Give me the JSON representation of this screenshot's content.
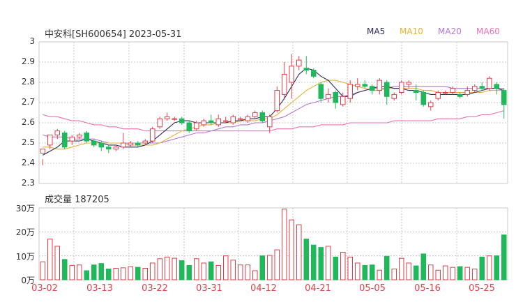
{
  "header": {
    "title": "中安科[SH600654] 2023-05-31"
  },
  "legend": [
    {
      "label": "MA5",
      "color": "#2c2c5e"
    },
    {
      "label": "MA10",
      "color": "#e8b233"
    },
    {
      "label": "MA20",
      "color": "#b476d4"
    },
    {
      "label": "MA60",
      "color": "#f06fb0"
    }
  ],
  "volume_title": "成交量 187205",
  "colors": {
    "up": "#e0404a",
    "down": "#1fb85a",
    "grid": "#c8c8c8",
    "axis_text": "#333333",
    "date_text": "#e0404a"
  },
  "chart_data": [
    {
      "type": "candlestick",
      "title": "中安科[SH600654] 2023-05-31",
      "ylim": [
        2.3,
        3.0
      ],
      "yticks": [
        "3",
        "2.9",
        "2.8",
        "2.7",
        "2.6",
        "2.5",
        "2.4",
        "2.3"
      ],
      "xticks": [
        "03-02",
        "03-13",
        "03-22",
        "03-31",
        "04-12",
        "04-21",
        "05-05",
        "05-16",
        "05-25"
      ],
      "candles": [
        [
          2.45,
          2.47,
          2.42,
          2.39
        ],
        [
          2.49,
          2.54,
          2.47,
          2.49
        ],
        [
          2.54,
          2.56,
          2.52,
          2.57
        ],
        [
          2.55,
          2.48,
          2.47,
          2.56
        ],
        [
          2.51,
          2.53,
          2.49,
          2.54
        ],
        [
          2.53,
          2.54,
          2.52,
          2.55
        ],
        [
          2.55,
          2.51,
          2.5,
          2.56
        ],
        [
          2.51,
          2.49,
          2.48,
          2.52
        ],
        [
          2.5,
          2.48,
          2.46,
          2.51
        ],
        [
          2.48,
          2.47,
          2.45,
          2.49
        ],
        [
          2.47,
          2.48,
          2.46,
          2.49
        ],
        [
          2.48,
          2.5,
          2.47,
          2.55
        ],
        [
          2.49,
          2.5,
          2.48,
          2.51
        ],
        [
          2.5,
          2.49,
          2.48,
          2.51
        ],
        [
          2.5,
          2.51,
          2.49,
          2.52
        ],
        [
          2.51,
          2.57,
          2.5,
          2.58
        ],
        [
          2.58,
          2.62,
          2.57,
          2.63
        ],
        [
          2.62,
          2.63,
          2.61,
          2.65
        ],
        [
          2.62,
          2.62,
          2.61,
          2.63
        ],
        [
          2.62,
          2.6,
          2.59,
          2.63
        ],
        [
          2.6,
          2.56,
          2.55,
          2.61
        ],
        [
          2.57,
          2.6,
          2.56,
          2.61
        ],
        [
          2.59,
          2.61,
          2.58,
          2.62
        ],
        [
          2.61,
          2.6,
          2.59,
          2.64
        ],
        [
          2.59,
          2.62,
          2.58,
          2.64
        ],
        [
          2.61,
          2.61,
          2.6,
          2.63
        ],
        [
          2.6,
          2.63,
          2.59,
          2.64
        ],
        [
          2.62,
          2.62,
          2.61,
          2.63
        ],
        [
          2.61,
          2.63,
          2.6,
          2.64
        ],
        [
          2.63,
          2.65,
          2.62,
          2.66
        ],
        [
          2.65,
          2.61,
          2.6,
          2.66
        ],
        [
          2.58,
          2.63,
          2.55,
          2.64
        ],
        [
          2.66,
          2.76,
          2.65,
          2.78
        ],
        [
          2.74,
          2.84,
          2.72,
          2.9
        ],
        [
          2.8,
          2.88,
          2.72,
          2.94
        ],
        [
          2.88,
          2.91,
          2.86,
          2.93
        ],
        [
          2.87,
          2.86,
          2.84,
          2.93
        ],
        [
          2.86,
          2.83,
          2.82,
          2.87
        ],
        [
          2.79,
          2.72,
          2.7,
          2.8
        ],
        [
          2.72,
          2.74,
          2.7,
          2.77
        ],
        [
          2.75,
          2.7,
          2.67,
          2.76
        ],
        [
          2.69,
          2.73,
          2.68,
          2.75
        ],
        [
          2.72,
          2.79,
          2.7,
          2.81
        ],
        [
          2.78,
          2.79,
          2.76,
          2.82
        ],
        [
          2.79,
          2.78,
          2.77,
          2.81
        ],
        [
          2.78,
          2.76,
          2.74,
          2.79
        ],
        [
          2.76,
          2.81,
          2.74,
          2.82
        ],
        [
          2.8,
          2.73,
          2.69,
          2.81
        ],
        [
          2.72,
          2.74,
          2.71,
          2.75
        ],
        [
          2.75,
          2.8,
          2.74,
          2.81
        ],
        [
          2.79,
          2.8,
          2.77,
          2.81
        ],
        [
          2.76,
          2.75,
          2.71,
          2.79
        ],
        [
          2.75,
          2.69,
          2.68,
          2.76
        ],
        [
          2.68,
          2.7,
          2.66,
          2.71
        ],
        [
          2.72,
          2.75,
          2.71,
          2.76
        ],
        [
          2.75,
          2.75,
          2.74,
          2.76
        ],
        [
          2.75,
          2.77,
          2.74,
          2.78
        ],
        [
          2.74,
          2.73,
          2.72,
          2.75
        ],
        [
          2.74,
          2.76,
          2.73,
          2.78
        ],
        [
          2.76,
          2.78,
          2.75,
          2.79
        ],
        [
          2.78,
          2.77,
          2.76,
          2.8
        ],
        [
          2.77,
          2.82,
          2.76,
          2.83
        ],
        [
          2.79,
          2.77,
          2.74,
          2.8
        ],
        [
          2.76,
          2.69,
          2.62,
          2.77
        ]
      ],
      "ma5": [
        2.44,
        2.46,
        2.48,
        2.51,
        2.51,
        2.51,
        2.52,
        2.51,
        2.5,
        2.49,
        2.49,
        2.48,
        2.48,
        2.48,
        2.49,
        2.51,
        2.54,
        2.57,
        2.6,
        2.61,
        2.61,
        2.6,
        2.6,
        2.6,
        2.6,
        2.6,
        2.61,
        2.61,
        2.62,
        2.62,
        2.63,
        2.63,
        2.67,
        2.72,
        2.78,
        2.84,
        2.87,
        2.86,
        2.83,
        2.81,
        2.77,
        2.73,
        2.73,
        2.75,
        2.76,
        2.77,
        2.78,
        2.78,
        2.77,
        2.77,
        2.76,
        2.76,
        2.75,
        2.74,
        2.74,
        2.74,
        2.74,
        2.74,
        2.74,
        2.75,
        2.76,
        2.77,
        2.77,
        2.76
      ],
      "ma10": [
        2.48,
        2.48,
        2.47,
        2.47,
        2.48,
        2.49,
        2.5,
        2.5,
        2.5,
        2.5,
        2.5,
        2.5,
        2.49,
        2.49,
        2.49,
        2.49,
        2.5,
        2.52,
        2.54,
        2.56,
        2.57,
        2.58,
        2.59,
        2.59,
        2.6,
        2.6,
        2.6,
        2.61,
        2.61,
        2.61,
        2.62,
        2.62,
        2.64,
        2.67,
        2.7,
        2.73,
        2.76,
        2.78,
        2.8,
        2.81,
        2.81,
        2.8,
        2.79,
        2.78,
        2.77,
        2.76,
        2.76,
        2.77,
        2.77,
        2.77,
        2.77,
        2.77,
        2.76,
        2.76,
        2.75,
        2.75,
        2.75,
        2.75,
        2.75,
        2.75,
        2.75,
        2.76,
        2.76,
        2.76
      ],
      "ma20": [
        2.54,
        2.53,
        2.53,
        2.53,
        2.52,
        2.52,
        2.52,
        2.52,
        2.51,
        2.5,
        2.5,
        2.5,
        2.5,
        2.5,
        2.5,
        2.5,
        2.5,
        2.51,
        2.52,
        2.53,
        2.54,
        2.55,
        2.55,
        2.56,
        2.57,
        2.58,
        2.58,
        2.59,
        2.59,
        2.6,
        2.6,
        2.61,
        2.62,
        2.63,
        2.65,
        2.67,
        2.69,
        2.7,
        2.71,
        2.72,
        2.73,
        2.73,
        2.74,
        2.75,
        2.76,
        2.77,
        2.77,
        2.77,
        2.78,
        2.78,
        2.78,
        2.78,
        2.78,
        2.78,
        2.78,
        2.78,
        2.77,
        2.77,
        2.77,
        2.77,
        2.77,
        2.77,
        2.77,
        2.77
      ],
      "ma60": [
        2.64,
        2.63,
        2.63,
        2.62,
        2.61,
        2.61,
        2.6,
        2.59,
        2.59,
        2.58,
        2.58,
        2.57,
        2.57,
        2.57,
        2.56,
        2.56,
        2.56,
        2.56,
        2.56,
        2.56,
        2.56,
        2.56,
        2.56,
        2.56,
        2.56,
        2.56,
        2.56,
        2.56,
        2.56,
        2.56,
        2.56,
        2.56,
        2.57,
        2.57,
        2.57,
        2.58,
        2.58,
        2.58,
        2.59,
        2.59,
        2.59,
        2.59,
        2.6,
        2.6,
        2.6,
        2.6,
        2.6,
        2.6,
        2.61,
        2.61,
        2.61,
        2.61,
        2.61,
        2.61,
        2.62,
        2.62,
        2.62,
        2.62,
        2.63,
        2.63,
        2.64,
        2.64,
        2.65,
        2.66
      ]
    },
    {
      "type": "bar",
      "title": "成交量 187205",
      "ylim": [
        0,
        300000
      ],
      "yticks": [
        "30万",
        "20万",
        "10万",
        "0万"
      ],
      "values": [
        75000,
        170000,
        140000,
        85000,
        60000,
        62000,
        38000,
        62000,
        68000,
        45000,
        48000,
        50000,
        55000,
        52000,
        48000,
        70000,
        88000,
        95000,
        90000,
        80000,
        60000,
        88000,
        70000,
        75000,
        60000,
        100000,
        82000,
        62000,
        62000,
        38000,
        100000,
        102000,
        125000,
        295000,
        250000,
        230000,
        170000,
        145000,
        135000,
        140000,
        95000,
        115000,
        95000,
        70000,
        60000,
        62000,
        40000,
        98000,
        45000,
        90000,
        70000,
        58000,
        108000,
        62000,
        40000,
        58000,
        52000,
        55000,
        52000,
        45000,
        95000,
        100000,
        100000,
        187205
      ]
    }
  ]
}
